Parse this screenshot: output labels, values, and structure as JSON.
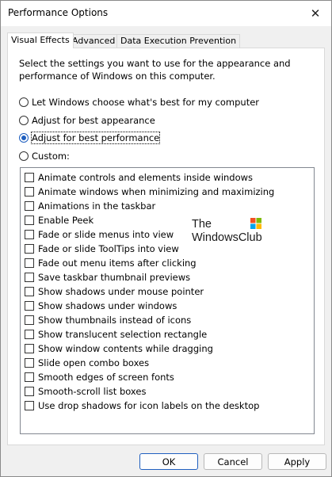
{
  "window": {
    "title": "Performance Options",
    "close_glyph": "✕"
  },
  "tabs": [
    {
      "label": "Visual Effects",
      "active": true
    },
    {
      "label": "Advanced",
      "active": false
    },
    {
      "label": "Data Execution Prevention",
      "active": false
    }
  ],
  "description": "Select the settings you want to use for the appearance and performance of Windows on this computer.",
  "radio_options": [
    {
      "label": "Let Windows choose what's best for my computer",
      "checked": false
    },
    {
      "label": "Adjust for best appearance",
      "checked": false
    },
    {
      "label": "Adjust for best performance",
      "checked": true
    },
    {
      "label": "Custom:",
      "checked": false
    }
  ],
  "effects": [
    {
      "label": "Animate controls and elements inside windows",
      "checked": false
    },
    {
      "label": "Animate windows when minimizing and maximizing",
      "checked": false
    },
    {
      "label": "Animations in the taskbar",
      "checked": false
    },
    {
      "label": "Enable Peek",
      "checked": false
    },
    {
      "label": "Fade or slide menus into view",
      "checked": false
    },
    {
      "label": "Fade or slide ToolTips into view",
      "checked": false
    },
    {
      "label": "Fade out menu items after clicking",
      "checked": false
    },
    {
      "label": "Save taskbar thumbnail previews",
      "checked": false
    },
    {
      "label": "Show shadows under mouse pointer",
      "checked": false
    },
    {
      "label": "Show shadows under windows",
      "checked": false
    },
    {
      "label": "Show thumbnails instead of icons",
      "checked": false
    },
    {
      "label": "Show translucent selection rectangle",
      "checked": false
    },
    {
      "label": "Show window contents while dragging",
      "checked": false
    },
    {
      "label": "Slide open combo boxes",
      "checked": false
    },
    {
      "label": "Smooth edges of screen fonts",
      "checked": false
    },
    {
      "label": "Smooth-scroll list boxes",
      "checked": false
    },
    {
      "label": "Use drop shadows for icon labels on the desktop",
      "checked": false
    }
  ],
  "watermark": {
    "line1": "The",
    "line2": "WindowsClub",
    "logo_colors": [
      "#f25022",
      "#7fba00",
      "#00a4ef",
      "#ffb900"
    ]
  },
  "buttons": {
    "ok": "OK",
    "cancel": "Cancel",
    "apply": "Apply"
  },
  "colors": {
    "accent": "#1f5fbf"
  }
}
